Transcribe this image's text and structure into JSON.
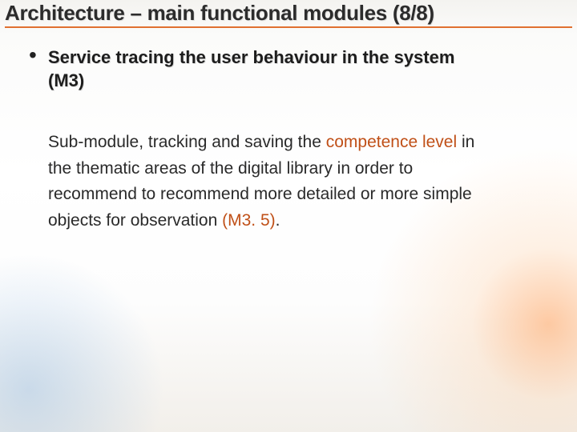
{
  "title": "Architecture – main functional modules (8/8)",
  "bullet": {
    "heading_line1": "Service tracing the user behaviour in the system",
    "heading_line2": "(M3)"
  },
  "paragraph": {
    "p1_a": "Sub-module, tracking and saving the ",
    "p1_hl": "competence level",
    "p1_b": " in",
    "p2": "the thematic areas of the digital library in order to",
    "p3": "recommend to recommend more detailed or more simple",
    "p4_a": "objects for observation ",
    "p4_hl": "(M3. 5)",
    "p4_b": "."
  }
}
